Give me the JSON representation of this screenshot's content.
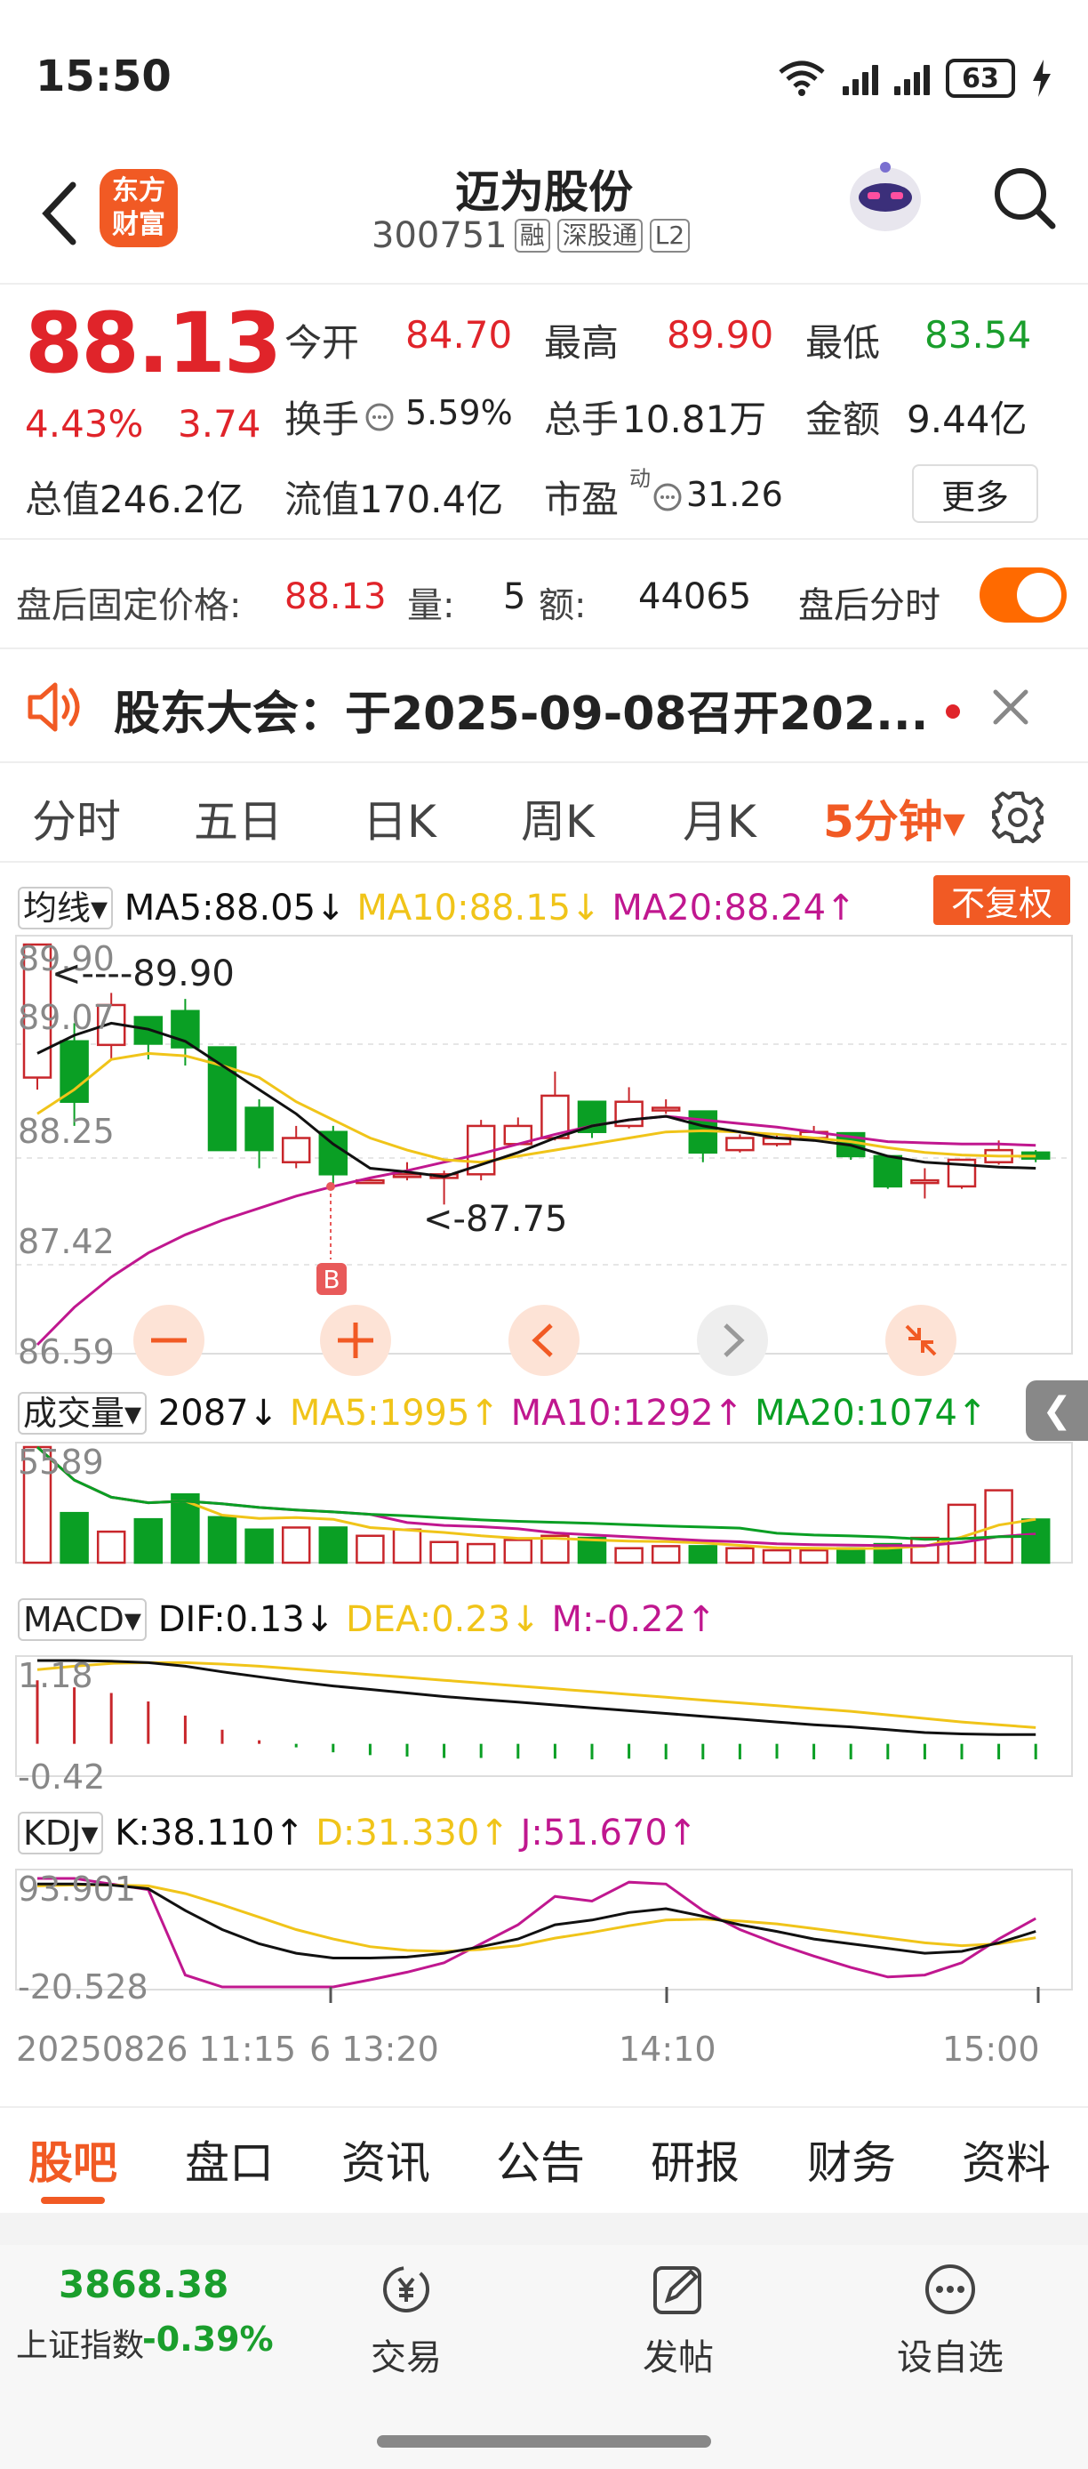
{
  "status": {
    "time": "15:50",
    "battery": "63"
  },
  "header": {
    "stock_name": "迈为股份",
    "stock_code": "300751",
    "tags": [
      "融",
      "深股通",
      "L2"
    ],
    "logo_text_top": "东方",
    "logo_text_bottom": "财富"
  },
  "quote": {
    "last_price": "88.13",
    "change_pct": "4.43%",
    "change_amt": "3.74",
    "open_label": "今开",
    "open": "84.70",
    "high_label": "最高",
    "high": "89.90",
    "low_label": "最低",
    "low": "83.54",
    "turnover_label": "换手",
    "turnover": "5.59%",
    "volume_label": "总手",
    "volume": "10.81万",
    "amount_label": "金额",
    "amount": "9.44亿",
    "mktcap_label": "总值",
    "mktcap": "246.2亿",
    "float_label": "流值",
    "float_cap": "170.4亿",
    "pe_label": "市盈",
    "pe_sup": "动",
    "pe": "31.26",
    "more_label": "更多"
  },
  "afterhours": {
    "price_label": "盘后固定价格:",
    "price": "88.13",
    "qty_label": "量:",
    "qty": "5",
    "amt_label": "额:",
    "amt": "44065",
    "timeshare_label": "盘后分时"
  },
  "notice": {
    "text": "股东大会：于2025-09-08召开202..."
  },
  "period_tabs": [
    "分时",
    "五日",
    "日K",
    "周K",
    "月K",
    "5分钟▾"
  ],
  "chart_labels": {
    "ma_select": "均线▾",
    "ma5": "MA5:88.05↓",
    "ma10": "MA10:88.15↓",
    "ma20": "MA20:88.24↑",
    "fq_button": "不复权",
    "price_ticks": [
      "89.90",
      "89.07",
      "88.25",
      "87.42",
      "86.59"
    ],
    "high_mark": "<----89.90",
    "low_mark": "<-87.75",
    "buy_marker": "B",
    "vol_select": "成交量▾",
    "vol_value": "2087↓",
    "vol_ma5": "MA5:1995↑",
    "vol_ma10": "MA10:1292↑",
    "vol_ma20": "MA20:1074↑",
    "vol_tick": "5589",
    "macd_select": "MACD▾",
    "dif": "DIF:0.13↓",
    "dea": "DEA:0.23↓",
    "m": "M:-0.22↑",
    "macd_ticks": [
      "1.18",
      "-0.42"
    ],
    "kdj_select": "KDJ▾",
    "k": "K:38.110↑",
    "d": "D:31.330↑",
    "j": "J:51.670↑",
    "kdj_ticks": [
      "93.901",
      "-20.528"
    ],
    "time_start": "20250826 11:15",
    "time_ticks": [
      "6 13:20",
      "14:10",
      "15:00"
    ]
  },
  "chart_data": {
    "type": "candlestick",
    "interval": "5分钟",
    "yticks": [
      89.9,
      89.07,
      88.25,
      87.42,
      86.59
    ],
    "ylim": [
      86.59,
      89.9
    ],
    "candles": [
      [
        88.8,
        89.9,
        89.9,
        88.7
      ],
      [
        89.1,
        88.6,
        89.25,
        88.4
      ],
      [
        89.07,
        89.4,
        89.5,
        88.95
      ],
      [
        89.3,
        89.08,
        89.3,
        88.95
      ],
      [
        89.35,
        89.05,
        89.45,
        88.9
      ],
      [
        89.05,
        88.2,
        89.05,
        88.2
      ],
      [
        88.55,
        88.2,
        88.62,
        88.05
      ],
      [
        88.1,
        88.3,
        88.4,
        88.05
      ],
      [
        88.35,
        88.0,
        88.4,
        87.9
      ],
      [
        87.95,
        87.95,
        87.98,
        87.93
      ],
      [
        88.0,
        88.0,
        88.1,
        87.95
      ],
      [
        87.97,
        88.0,
        88.03,
        87.75
      ],
      [
        88.0,
        88.4,
        88.45,
        87.95
      ],
      [
        88.25,
        88.4,
        88.47,
        88.24
      ],
      [
        88.3,
        88.65,
        88.85,
        88.28
      ],
      [
        88.6,
        88.35,
        88.6,
        88.3
      ],
      [
        88.4,
        88.6,
        88.72,
        88.38
      ],
      [
        88.55,
        88.55,
        88.62,
        88.5
      ],
      [
        88.52,
        88.18,
        88.52,
        88.1
      ],
      [
        88.2,
        88.3,
        88.33,
        88.18
      ],
      [
        88.25,
        88.3,
        88.33,
        88.23
      ],
      [
        88.3,
        88.35,
        88.4,
        88.27
      ],
      [
        88.34,
        88.15,
        88.34,
        88.12
      ],
      [
        88.15,
        87.9,
        88.15,
        87.88
      ],
      [
        87.95,
        87.95,
        88.05,
        87.8
      ],
      [
        87.9,
        88.12,
        88.12,
        87.88
      ],
      [
        88.1,
        88.2,
        88.28,
        88.08
      ],
      [
        88.18,
        88.13,
        88.2,
        88.1
      ]
    ],
    "ma5": [
      89.0,
      89.15,
      89.25,
      89.2,
      89.1,
      88.9,
      88.7,
      88.5,
      88.25,
      88.05,
      88.02,
      87.98,
      88.08,
      88.18,
      88.3,
      88.4,
      88.45,
      88.48,
      88.4,
      88.35,
      88.3,
      88.28,
      88.24,
      88.15,
      88.1,
      88.08,
      88.06,
      88.05
    ],
    "ma10": [
      88.5,
      88.7,
      88.95,
      89.0,
      88.98,
      88.9,
      88.8,
      88.6,
      88.45,
      88.3,
      88.2,
      88.12,
      88.1,
      88.15,
      88.2,
      88.25,
      88.3,
      88.35,
      88.36,
      88.35,
      88.33,
      88.3,
      88.27,
      88.22,
      88.18,
      88.16,
      88.15,
      88.15
    ],
    "ma20": [
      86.59,
      86.9,
      87.15,
      87.35,
      87.5,
      87.62,
      87.72,
      87.82,
      87.9,
      87.97,
      88.03,
      88.1,
      88.17,
      88.25,
      88.33,
      88.4,
      88.45,
      88.48,
      88.45,
      88.42,
      88.39,
      88.35,
      88.31,
      88.27,
      88.26,
      88.25,
      88.25,
      88.24
    ],
    "volume": [
      5589,
      2400,
      1500,
      2100,
      3300,
      2200,
      1600,
      1700,
      1700,
      1300,
      1600,
      1000,
      900,
      1100,
      1300,
      1200,
      700,
      800,
      800,
      700,
      600,
      600,
      700,
      900,
      1200,
      2800,
      3500,
      2087
    ],
    "vol_ylim": [
      0,
      5589
    ],
    "macd_hist": [
      0.9,
      0.8,
      0.72,
      0.6,
      0.4,
      0.2,
      0.05,
      -0.05,
      -0.12,
      -0.16,
      -0.18,
      -0.2,
      -0.2,
      -0.21,
      -0.21,
      -0.22,
      -0.21,
      -0.22,
      -0.22,
      -0.22,
      -0.21,
      -0.22,
      -0.22,
      -0.22,
      -0.22,
      -0.22,
      -0.22,
      -0.22
    ],
    "dif": [
      1.18,
      1.18,
      1.17,
      1.15,
      1.1,
      1.02,
      0.95,
      0.88,
      0.82,
      0.77,
      0.72,
      0.67,
      0.63,
      0.59,
      0.55,
      0.51,
      0.47,
      0.43,
      0.39,
      0.35,
      0.31,
      0.27,
      0.24,
      0.2,
      0.16,
      0.14,
      0.13,
      0.13
    ],
    "dea": [
      1.05,
      1.1,
      1.14,
      1.15,
      1.15,
      1.13,
      1.1,
      1.06,
      1.02,
      0.98,
      0.94,
      0.9,
      0.86,
      0.82,
      0.78,
      0.74,
      0.7,
      0.66,
      0.62,
      0.58,
      0.54,
      0.5,
      0.46,
      0.41,
      0.36,
      0.31,
      0.27,
      0.23
    ],
    "macd_ylim": [
      -0.42,
      1.18
    ],
    "k": [
      88,
      88,
      87,
      83,
      60,
      40,
      25,
      15,
      10,
      10,
      11,
      15,
      22,
      30,
      45,
      50,
      58,
      62,
      54,
      45,
      38,
      30,
      25,
      20,
      15,
      17,
      26,
      38.11
    ],
    "d": [
      86,
      87,
      87,
      86,
      78,
      66,
      53,
      40,
      30,
      22,
      18,
      17,
      19,
      23,
      31,
      37,
      44,
      50,
      51,
      49,
      46,
      41,
      36,
      31,
      26,
      23,
      25,
      31.33
    ],
    "j": [
      93.9,
      93.9,
      88,
      82,
      -8,
      -20.528,
      -20.528,
      -20.528,
      -20.528,
      -13,
      -5,
      5,
      25,
      45,
      75,
      70,
      90,
      88,
      60,
      40,
      25,
      12,
      0,
      -10,
      -8,
      5,
      30,
      51.67
    ],
    "kdj_ylim": [
      -20.528,
      93.901
    ],
    "colors": {
      "up": "#c8262b",
      "down": "#0a9f24",
      "ma5": "#111111",
      "ma10": "#f0c419",
      "ma20": "#c0178f",
      "vol_ma5": "#f0c419",
      "vol_ma10": "#c0178f",
      "vol_ma20": "#0a9f24",
      "dif": "#111111",
      "dea": "#f0c419",
      "k": "#111111",
      "d": "#f0c419",
      "j": "#c0178f"
    }
  },
  "bottom_tabs": [
    "股吧",
    "盘口",
    "资讯",
    "公告",
    "研报",
    "财务",
    "资料"
  ],
  "footer": {
    "index_value": "3868.38",
    "index_name": "上证指数",
    "index_change": "-0.39%",
    "trade_label": "交易",
    "post_label": "发帖",
    "watch_label": "设自选"
  }
}
